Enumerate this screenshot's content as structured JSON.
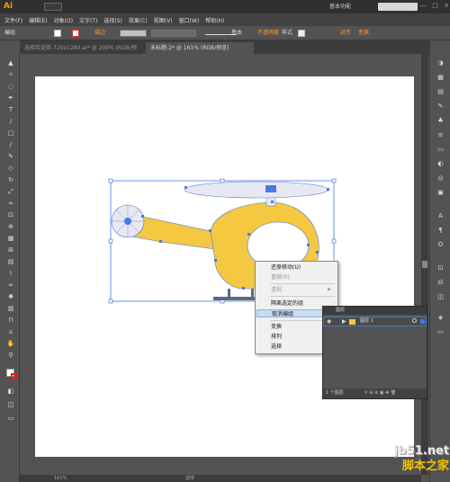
{
  "app": {
    "logo": "Ai",
    "bridge": "Br",
    "workspace": "基本功能",
    "window_controls": [
      "—",
      "□",
      "×"
    ]
  },
  "menubar": [
    "文件(F)",
    "编辑(E)",
    "对象(O)",
    "文字(T)",
    "选择(S)",
    "效果(C)",
    "视图(V)",
    "窗口(W)",
    "帮助(H)"
  ],
  "control_bar": {
    "selection_type": "编组",
    "stroke_label": "描边",
    "stroke_style": "基本",
    "opacity_label": "不透明度",
    "style_label": "样式",
    "align_label": "对齐",
    "transform_label": "变换"
  },
  "tabs": [
    {
      "label": "选择欢迎页-720x1280.ai* @ 200% (RGB/预览)",
      "active": false
    },
    {
      "label": "未标题-2* @ 161% (RGB/预览)",
      "active": true
    }
  ],
  "context_menu": {
    "items": [
      {
        "label": "还原移动(U)",
        "disabled": false,
        "has_submenu": false,
        "highlighted": false
      },
      {
        "label": "重做(R)",
        "disabled": true,
        "has_submenu": false,
        "highlighted": false
      },
      {
        "label": "透视",
        "disabled": true,
        "has_submenu": true,
        "highlighted": false
      },
      {
        "label": "隔离选定的组",
        "disabled": false,
        "has_submenu": false,
        "highlighted": false
      },
      {
        "label": "取消编组",
        "disabled": false,
        "has_submenu": false,
        "highlighted": true
      },
      {
        "label": "变换",
        "disabled": false,
        "has_submenu": true,
        "highlighted": false
      },
      {
        "label": "排列",
        "disabled": false,
        "has_submenu": true,
        "highlighted": false
      },
      {
        "label": "选择",
        "disabled": false,
        "has_submenu": true,
        "highlighted": false
      }
    ]
  },
  "layers_panel": {
    "title": "图层",
    "layer_name": "图层 1",
    "footer_count": "1 个图层"
  },
  "statusbar": {
    "zoom": "161%",
    "label": "选择"
  },
  "watermark": {
    "line1": "jb51.net",
    "line2": "脚本之家"
  },
  "colors": {
    "accent": "#ff9a00",
    "helicopter_body": "#f5c842",
    "selection_blue": "#4a78e0",
    "highlight": "#c8dcf4"
  }
}
